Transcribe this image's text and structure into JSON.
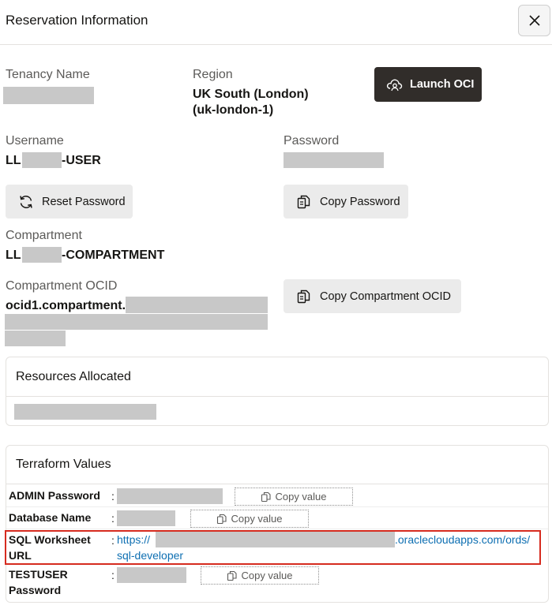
{
  "header": {
    "title": "Reservation Information",
    "close_label": "Close"
  },
  "tenancy": {
    "label": "Tenancy Name"
  },
  "region": {
    "label": "Region",
    "value_line1": "UK South (London)",
    "value_line2": "(uk-london-1)"
  },
  "launch_button": {
    "label": "Launch OCI"
  },
  "username": {
    "label": "Username",
    "prefix": "LL",
    "suffix": "-USER"
  },
  "password": {
    "label": "Password"
  },
  "reset_button": {
    "label": "Reset Password"
  },
  "copy_password_button": {
    "label": "Copy Password"
  },
  "compartment": {
    "label": "Compartment",
    "prefix": "LL",
    "suffix": "-COMPARTMENT"
  },
  "compartment_ocid": {
    "label": "Compartment OCID",
    "prefix": "ocid1.compartment."
  },
  "copy_ocid_button": {
    "label": "Copy Compartment OCID"
  },
  "resources": {
    "title": "Resources Allocated"
  },
  "terraform": {
    "title": "Terraform Values",
    "copy_label": "Copy value",
    "rows": [
      {
        "label": "ADMIN Password"
      },
      {
        "label": "Database Name"
      },
      {
        "label_line1": "SQL Worksheet",
        "label_line2": "URL",
        "url_start": "https://",
        "url_end": ".oraclecloudapps.com/ords/",
        "url_line2": "sql-developer"
      },
      {
        "label_line1": "TESTUSER",
        "label_line2": "Password"
      }
    ],
    "colon": ":"
  },
  "colors": {
    "accent_dark": "#312d2a",
    "link": "#0e6fb2",
    "highlight": "#d62b1f"
  }
}
